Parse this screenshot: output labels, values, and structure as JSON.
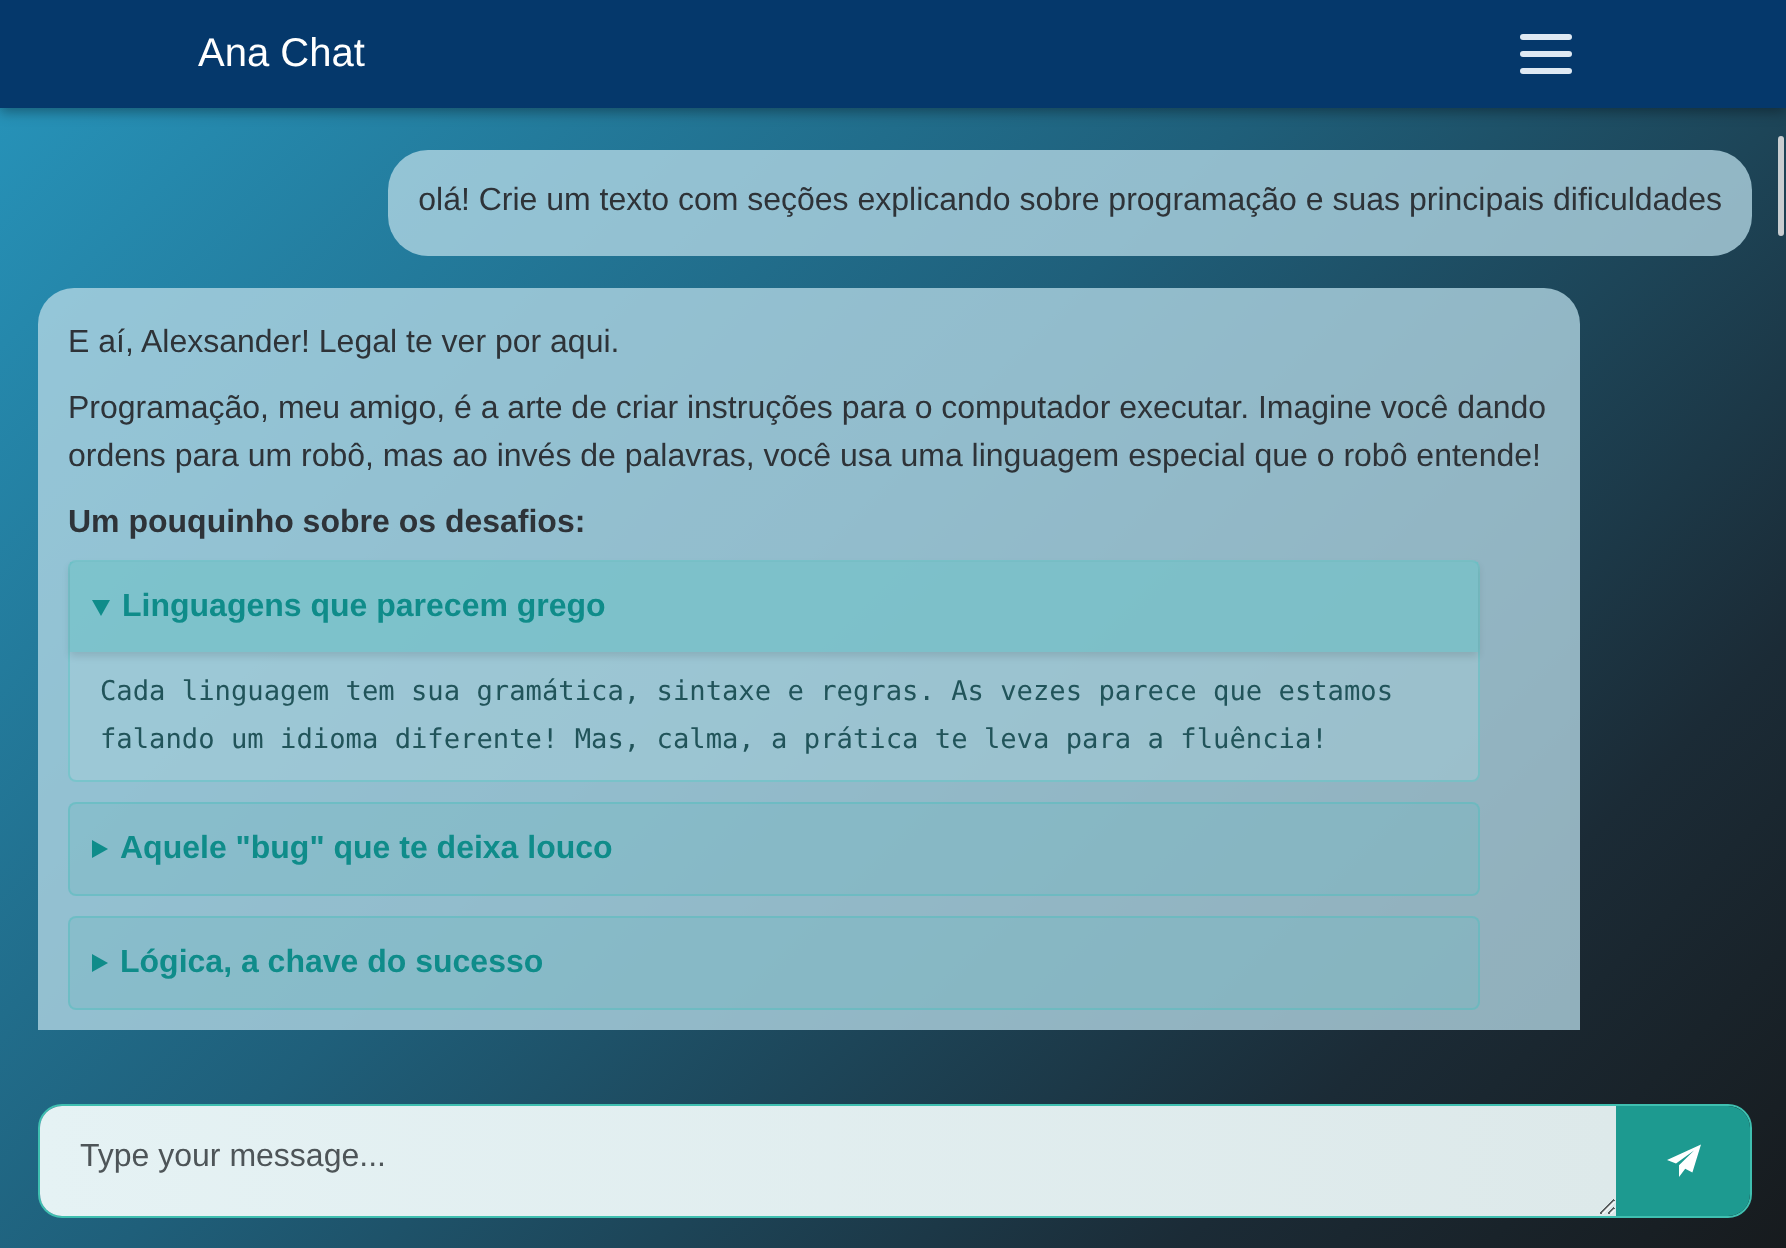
{
  "header": {
    "title": "Ana Chat"
  },
  "messages": [
    {
      "kind": "user",
      "text": "olá! Crie um texto com seções explicando sobre programação e suas principais dificuldades"
    },
    {
      "kind": "bot",
      "paragraphs": [
        "E aí, Alexsander! Legal te ver por aqui.",
        "Programação, meu amigo, é a arte de criar instruções para o computador executar. Imagine você dando ordens para um robô, mas ao invés de palavras, você usa uma linguagem especial que o robô entende!"
      ],
      "heading": "Um pouquinho sobre os desafios:",
      "sections": [
        {
          "title": "Linguagens que parecem grego",
          "expanded": true,
          "body": "Cada linguagem tem sua gramática, sintaxe e regras. As vezes parece que estamos falando um idioma diferente! Mas, calma, a prática te leva para a fluência!"
        },
        {
          "title": "Aquele \"bug\" que te deixa louco",
          "expanded": false
        },
        {
          "title": "Lógica, a chave do sucesso",
          "expanded": false
        }
      ]
    }
  ],
  "composer": {
    "placeholder": "Type your message..."
  }
}
